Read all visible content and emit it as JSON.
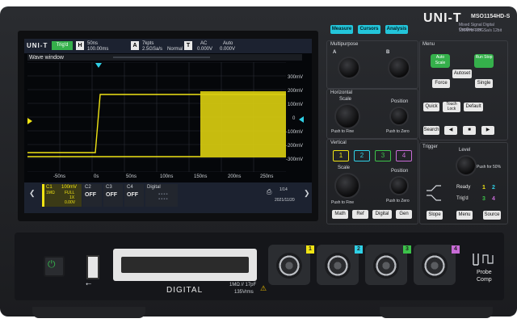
{
  "brand": {
    "logo": "UNI-T",
    "model": "MSO1154HD-S",
    "tagline": "Mixed Signal Digital Oscilloscope",
    "specs": "150MHz 2.5GSa/s 12bit"
  },
  "top_buttons": [
    "Measure",
    "Cursors",
    "Analysis"
  ],
  "screen": {
    "status": {
      "logo": "UNI-T",
      "run_state": "Trig'd",
      "mode": "H",
      "timebase": "50ns",
      "rate": "100.00ms",
      "acq": "A",
      "trig_label": "T",
      "coupling": "AC",
      "trig_level": "0.000V",
      "sample": "7kpts",
      "sample_rate": "2.5GSa/s",
      "acq_mode": "Normal",
      "auto": "Auto",
      "memory": "0.000V"
    },
    "title": "Wave window",
    "y_ticks": [
      "300mV",
      "200mV",
      "100mV",
      "0",
      "-100mV",
      "-200mV",
      "-300mV"
    ],
    "x_ticks": [
      "-50ns",
      "0s",
      "50ns",
      "100ns",
      "150ns",
      "200ns",
      "250ns"
    ],
    "channels": [
      {
        "name": "C1",
        "scale": "100mV",
        "coupling": "1MΩ",
        "bw": "FULL",
        "probe": "1X",
        "offset": "0.00V"
      },
      {
        "name": "C2",
        "value": "OFF"
      },
      {
        "name": "C3",
        "value": "OFF"
      },
      {
        "name": "C4",
        "value": "OFF"
      }
    ],
    "digital": "Digital",
    "page": "1/14",
    "date": "2021/11/20"
  },
  "panels": {
    "multipurpose": "Multipurpose",
    "a": "A",
    "b": "B",
    "horizontal": "Horizontal",
    "scale": "Scale",
    "position": "Position",
    "push_fine": "Push to Fine",
    "push_zero": "Push to Zero",
    "vertical": "Vertical",
    "ch": [
      "1",
      "2",
      "3",
      "4"
    ],
    "math": "Math",
    "ref": "Ref",
    "digital": "Digital",
    "gen": "Gen",
    "menu": "Menu",
    "auto_scale": "Auto Scale",
    "run_stop": "Run Stop",
    "autoset": "Autoset",
    "force": "Force",
    "single": "Single",
    "quick": "Quick",
    "touch_lock": "Touch Lock",
    "default": "Default",
    "search": "Search",
    "trigger": "Trigger",
    "level": "Level",
    "push_50": "Push for 50%",
    "ready": "Ready",
    "trigd": "Trig'd",
    "slope": "Slope",
    "menu2": "Menu",
    "source": "Source"
  },
  "front": {
    "digital_label": "DIGITAL",
    "input_spec": "1MΩ // 17pF",
    "input_max": "135Vrms",
    "probe": "Probe",
    "comp": "Comp",
    "channel_numbers": [
      "1",
      "2",
      "3",
      "4"
    ]
  },
  "colors": {
    "ch1": "#f0e414",
    "ch2": "#2fd0e6",
    "ch3": "#3cc24a",
    "ch4": "#c86bd6",
    "accent": "#23c5da"
  }
}
